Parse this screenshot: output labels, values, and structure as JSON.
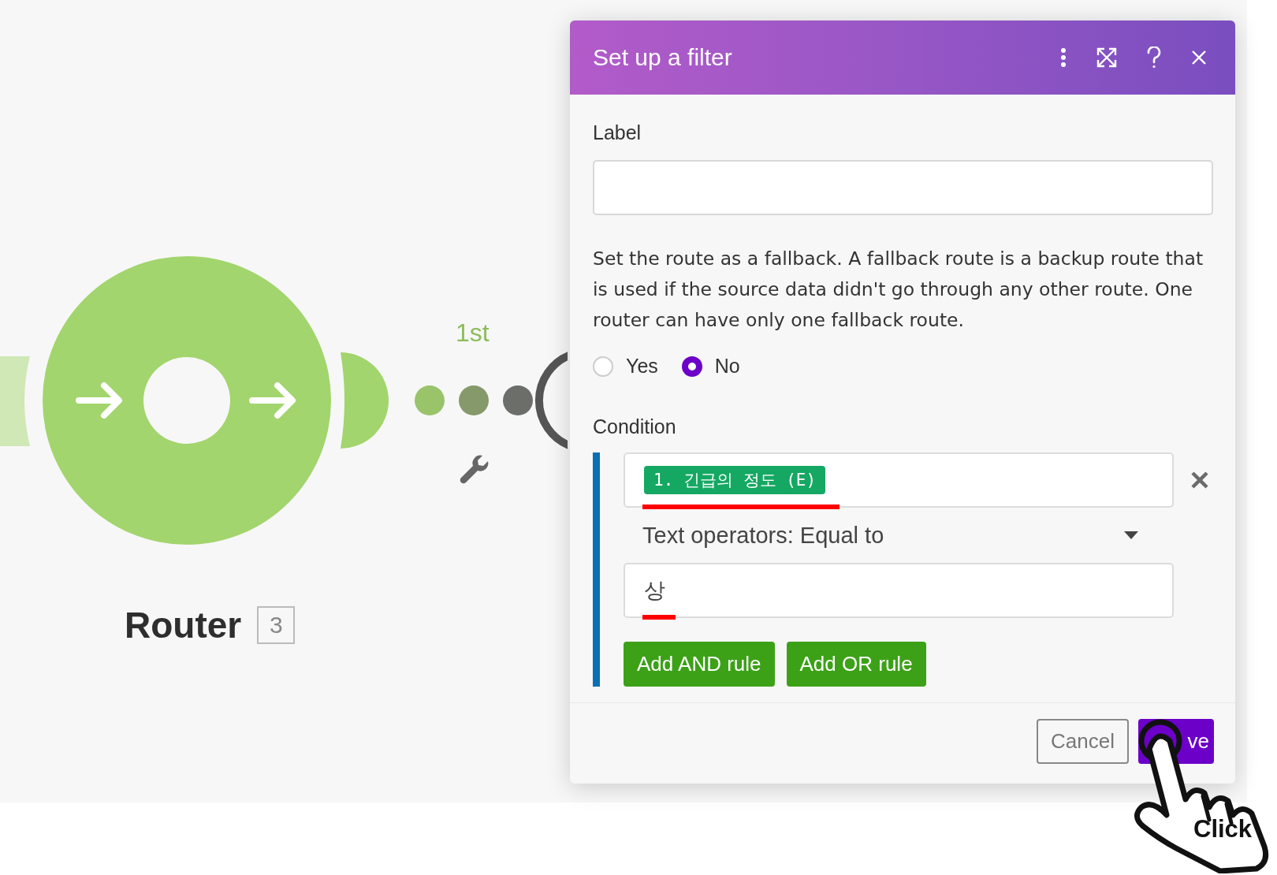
{
  "canvas": {
    "route_label": "1st",
    "router": {
      "label": "Router",
      "badge": "3"
    }
  },
  "dialog": {
    "title": "Set up a filter",
    "label_field": {
      "label": "Label"
    },
    "fallback_text": "Set the route as a fallback. A fallback route is a backup route that is used if the source data didn't go through any other route. One router can have only one fallback route.",
    "fallback_options": [
      {
        "label": "Yes",
        "selected": false
      },
      {
        "label": "No",
        "selected": true
      }
    ],
    "condition": {
      "label": "Condition",
      "operand_tag": "1. 긴급의 정도 (E)",
      "operator": "Text operators: Equal to",
      "value": "상"
    },
    "rule_buttons": [
      "Add AND rule",
      "Add OR rule"
    ],
    "footer_buttons": [
      {
        "label": "Cancel",
        "kind": "secondary"
      },
      {
        "label": "ve",
        "kind": "primary"
      }
    ]
  },
  "pointer": {
    "caption": "Click"
  }
}
